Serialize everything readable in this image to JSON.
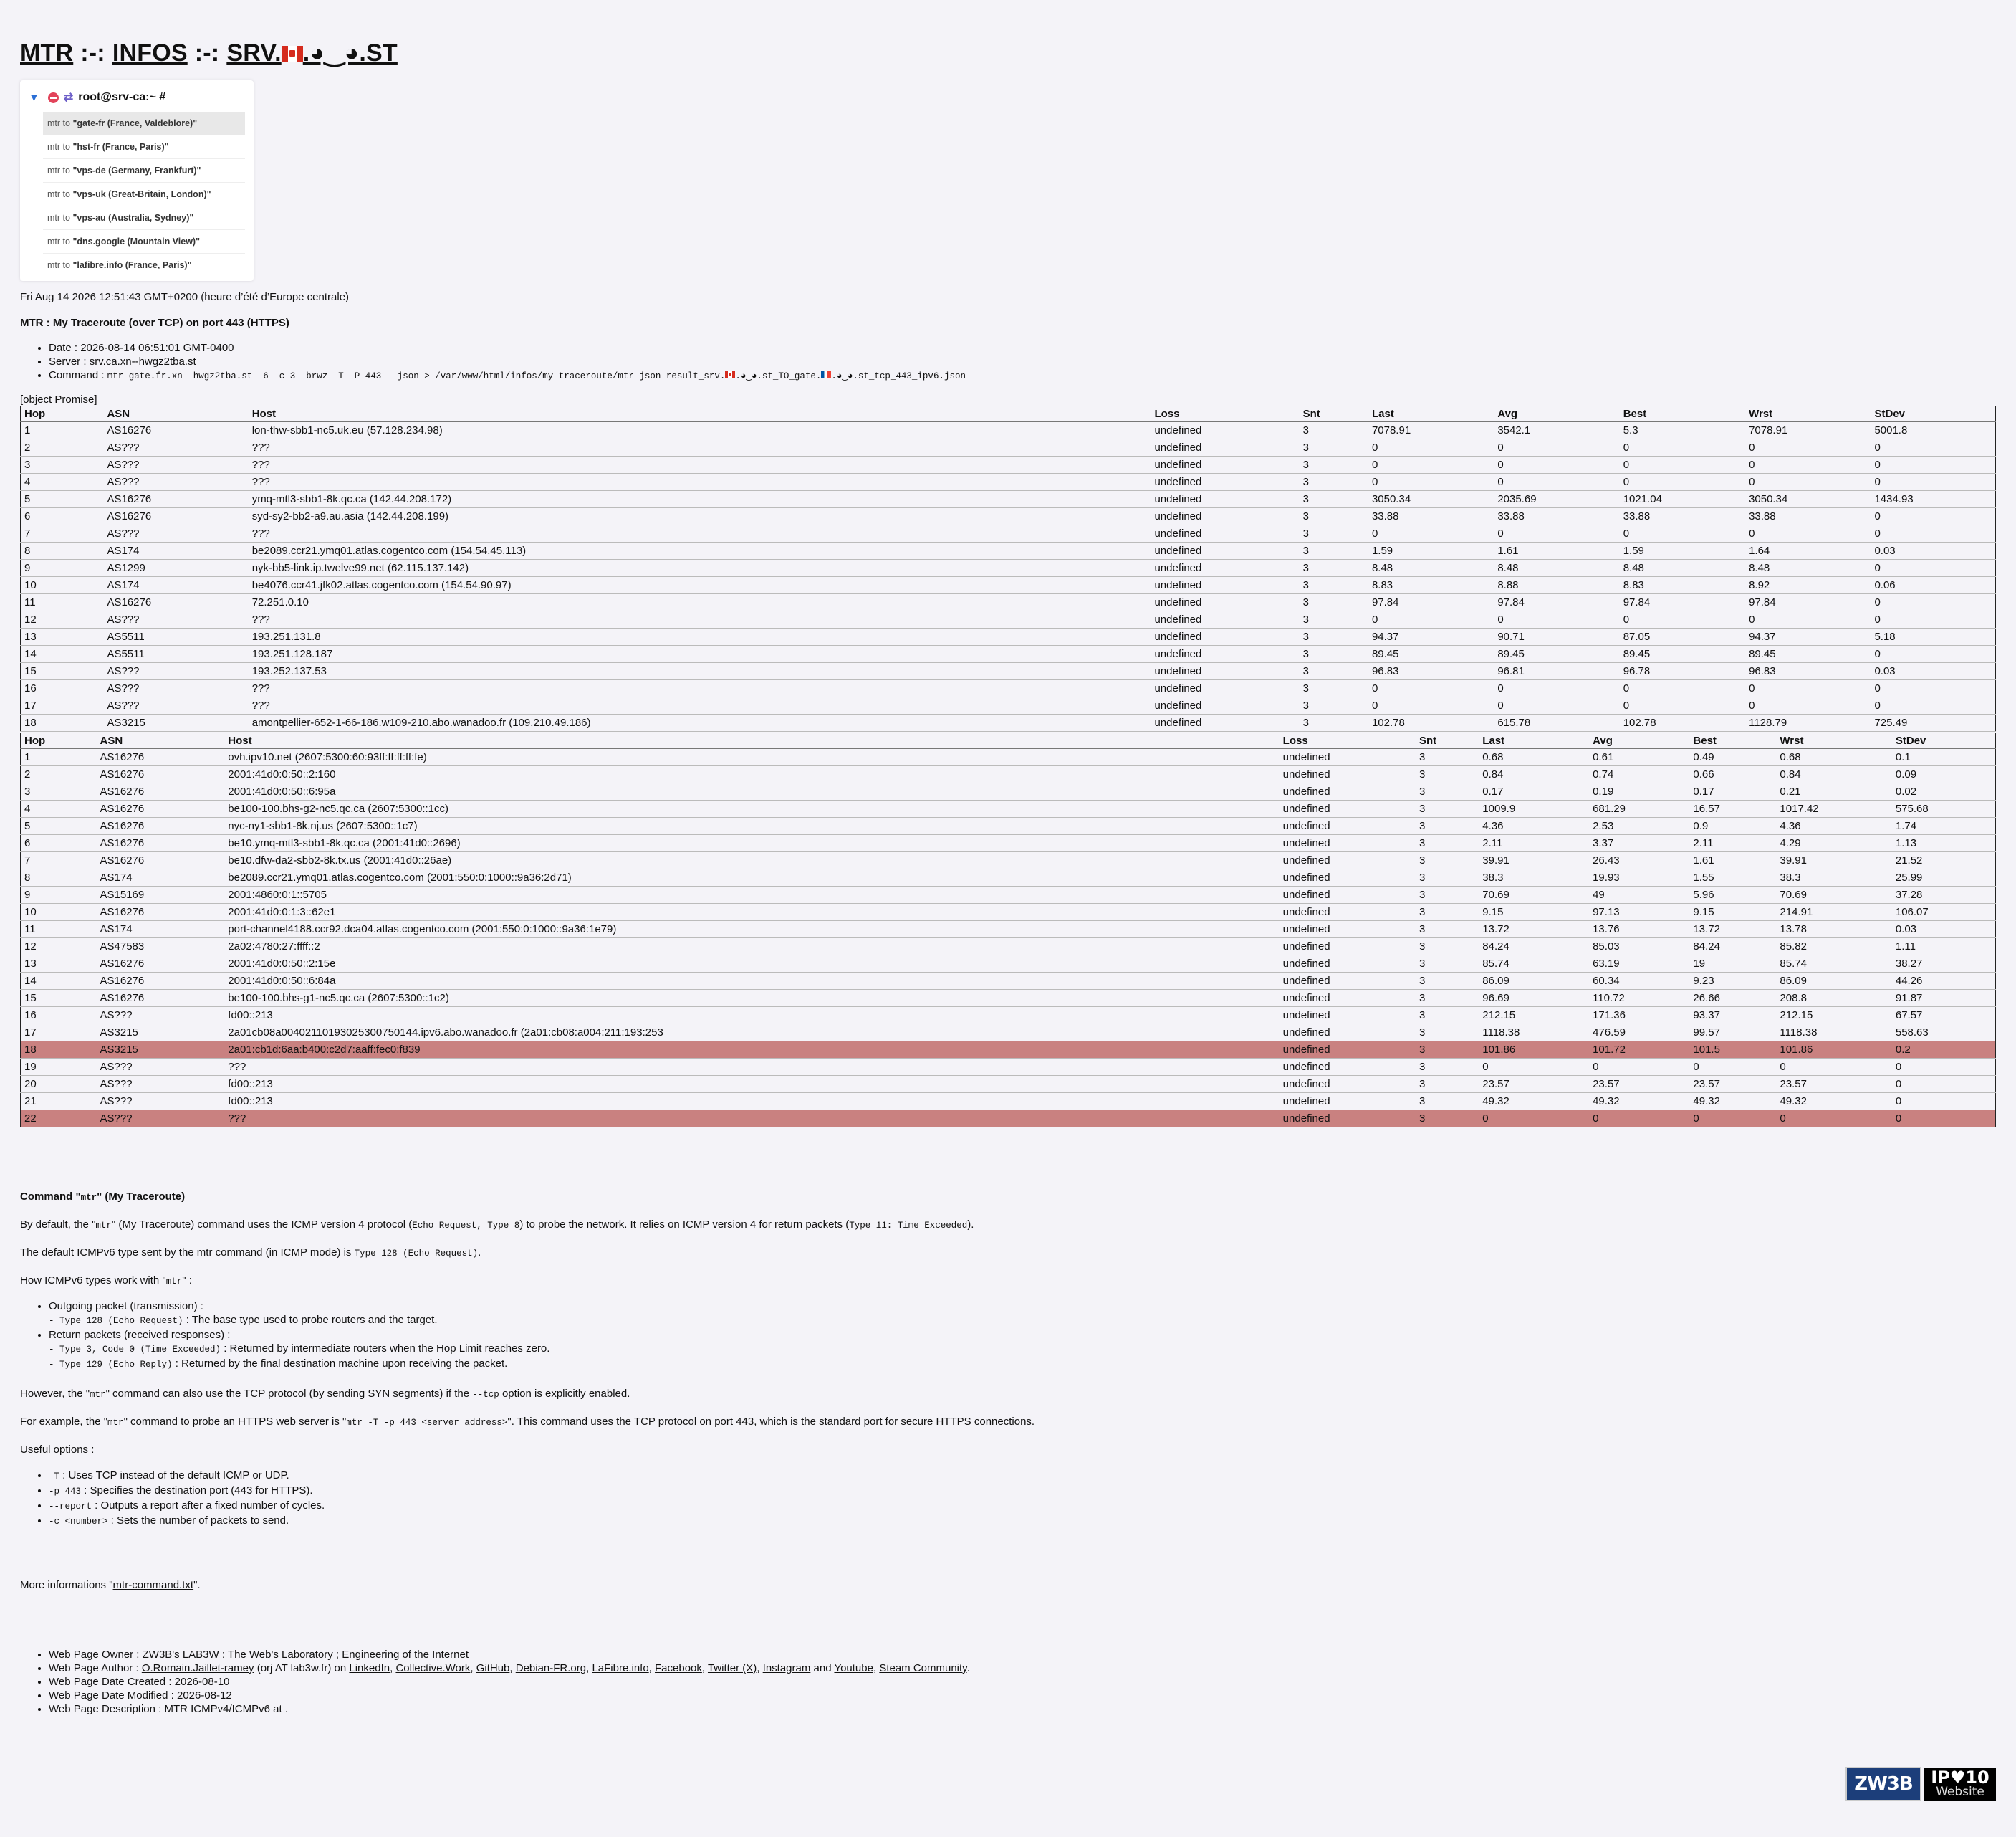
{
  "header": {
    "mtr": "MTR",
    "sep": ":-:",
    "infos": "INFOS",
    "srv_prefix": "SRV.",
    "srv_suffix": ".◕‿◕.ST"
  },
  "menu": {
    "prompt": "root@srv-ca:~ #",
    "prefix": "mtr to",
    "items": [
      "\"gate-fr (France, Valdeblore)\"",
      "\"hst-fr (France, Paris)\"",
      "\"vps-de (Germany, Frankfurt)\"",
      "\"vps-uk (Great-Britain, London)\"",
      "\"vps-au (Australia, Sydney)\"",
      "\"dns.google (Mountain View)\"",
      "\"lafibre.info (France, Paris)\""
    ]
  },
  "date_line": "Fri Aug 14 2026 12:51:43 GMT+0200 (heure d’été d’Europe centrale)",
  "mtr_title": "MTR : My Traceroute (over TCP) on port 443 (HTTPS)",
  "meta": {
    "date_label": "Date :",
    "date": "2026-08-14 06:51:01 GMT-0400",
    "server_label": "Server :",
    "server": "srv.ca.xn--hwgz2tba.st",
    "command_label": "Command :",
    "command_a": "mtr gate.fr.xn--hwgz2tba.st -6 -c 3 -brwz -T -P 443 --json > /var/www/html/infos/my-traceroute/mtr-json-result_srv.",
    "command_b": ".◕‿◕.st_TO_gate.",
    "command_c": ".◕‿◕.st_tcp_443_ipv6.json"
  },
  "promise": "[object Promise]",
  "columns": [
    "Hop",
    "ASN",
    "Host",
    "Loss",
    "Snt",
    "Last",
    "Avg",
    "Best",
    "Wrst",
    "StDev"
  ],
  "table1": [
    [
      "1",
      "AS16276",
      "lon-thw-sbb1-nc5.uk.eu (57.128.234.98)",
      "undefined",
      "3",
      "7078.91",
      "3542.1",
      "5.3",
      "7078.91",
      "5001.8"
    ],
    [
      "2",
      "AS???",
      "???",
      "undefined",
      "3",
      "0",
      "0",
      "0",
      "0",
      "0"
    ],
    [
      "3",
      "AS???",
      "???",
      "undefined",
      "3",
      "0",
      "0",
      "0",
      "0",
      "0"
    ],
    [
      "4",
      "AS???",
      "???",
      "undefined",
      "3",
      "0",
      "0",
      "0",
      "0",
      "0"
    ],
    [
      "5",
      "AS16276",
      "ymq-mtl3-sbb1-8k.qc.ca (142.44.208.172)",
      "undefined",
      "3",
      "3050.34",
      "2035.69",
      "1021.04",
      "3050.34",
      "1434.93"
    ],
    [
      "6",
      "AS16276",
      "syd-sy2-bb2-a9.au.asia (142.44.208.199)",
      "undefined",
      "3",
      "33.88",
      "33.88",
      "33.88",
      "33.88",
      "0"
    ],
    [
      "7",
      "AS???",
      "???",
      "undefined",
      "3",
      "0",
      "0",
      "0",
      "0",
      "0"
    ],
    [
      "8",
      "AS174",
      "be2089.ccr21.ymq01.atlas.cogentco.com (154.54.45.113)",
      "undefined",
      "3",
      "1.59",
      "1.61",
      "1.59",
      "1.64",
      "0.03"
    ],
    [
      "9",
      "AS1299",
      "nyk-bb5-link.ip.twelve99.net (62.115.137.142)",
      "undefined",
      "3",
      "8.48",
      "8.48",
      "8.48",
      "8.48",
      "0"
    ],
    [
      "10",
      "AS174",
      "be4076.ccr41.jfk02.atlas.cogentco.com (154.54.90.97)",
      "undefined",
      "3",
      "8.83",
      "8.88",
      "8.83",
      "8.92",
      "0.06"
    ],
    [
      "11",
      "AS16276",
      "72.251.0.10",
      "undefined",
      "3",
      "97.84",
      "97.84",
      "97.84",
      "97.84",
      "0"
    ],
    [
      "12",
      "AS???",
      "???",
      "undefined",
      "3",
      "0",
      "0",
      "0",
      "0",
      "0"
    ],
    [
      "13",
      "AS5511",
      "193.251.131.8",
      "undefined",
      "3",
      "94.37",
      "90.71",
      "87.05",
      "94.37",
      "5.18"
    ],
    [
      "14",
      "AS5511",
      "193.251.128.187",
      "undefined",
      "3",
      "89.45",
      "89.45",
      "89.45",
      "89.45",
      "0"
    ],
    [
      "15",
      "AS???",
      "193.252.137.53",
      "undefined",
      "3",
      "96.83",
      "96.81",
      "96.78",
      "96.83",
      "0.03"
    ],
    [
      "16",
      "AS???",
      "???",
      "undefined",
      "3",
      "0",
      "0",
      "0",
      "0",
      "0"
    ],
    [
      "17",
      "AS???",
      "???",
      "undefined",
      "3",
      "0",
      "0",
      "0",
      "0",
      "0"
    ],
    [
      "18",
      "AS3215",
      "amontpellier-652-1-66-186.w109-210.abo.wanadoo.fr (109.210.49.186)",
      "undefined",
      "3",
      "102.78",
      "615.78",
      "102.78",
      "1128.79",
      "725.49"
    ]
  ],
  "table2_highlight": [
    "18",
    "22"
  ],
  "table2": [
    [
      "1",
      "AS16276",
      "ovh.ipv10.net (2607:5300:60:93ff:ff:ff:ff:fe)",
      "undefined",
      "3",
      "0.68",
      "0.61",
      "0.49",
      "0.68",
      "0.1"
    ],
    [
      "2",
      "AS16276",
      "2001:41d0:0:50::2:160",
      "undefined",
      "3",
      "0.84",
      "0.74",
      "0.66",
      "0.84",
      "0.09"
    ],
    [
      "3",
      "AS16276",
      "2001:41d0:0:50::6:95a",
      "undefined",
      "3",
      "0.17",
      "0.19",
      "0.17",
      "0.21",
      "0.02"
    ],
    [
      "4",
      "AS16276",
      "be100-100.bhs-g2-nc5.qc.ca (2607:5300::1cc)",
      "undefined",
      "3",
      "1009.9",
      "681.29",
      "16.57",
      "1017.42",
      "575.68"
    ],
    [
      "5",
      "AS16276",
      "nyc-ny1-sbb1-8k.nj.us (2607:5300::1c7)",
      "undefined",
      "3",
      "4.36",
      "2.53",
      "0.9",
      "4.36",
      "1.74"
    ],
    [
      "6",
      "AS16276",
      "be10.ymq-mtl3-sbb1-8k.qc.ca (2001:41d0::2696)",
      "undefined",
      "3",
      "2.11",
      "3.37",
      "2.11",
      "4.29",
      "1.13"
    ],
    [
      "7",
      "AS16276",
      "be10.dfw-da2-sbb2-8k.tx.us (2001:41d0::26ae)",
      "undefined",
      "3",
      "39.91",
      "26.43",
      "1.61",
      "39.91",
      "21.52"
    ],
    [
      "8",
      "AS174",
      "be2089.ccr21.ymq01.atlas.cogentco.com (2001:550:0:1000::9a36:2d71)",
      "undefined",
      "3",
      "38.3",
      "19.93",
      "1.55",
      "38.3",
      "25.99"
    ],
    [
      "9",
      "AS15169",
      "2001:4860:0:1::5705",
      "undefined",
      "3",
      "70.69",
      "49",
      "5.96",
      "70.69",
      "37.28"
    ],
    [
      "10",
      "AS16276",
      "2001:41d0:0:1:3::62e1",
      "undefined",
      "3",
      "9.15",
      "97.13",
      "9.15",
      "214.91",
      "106.07"
    ],
    [
      "11",
      "AS174",
      "port-channel4188.ccr92.dca04.atlas.cogentco.com (2001:550:0:1000::9a36:1e79)",
      "undefined",
      "3",
      "13.72",
      "13.76",
      "13.72",
      "13.78",
      "0.03"
    ],
    [
      "12",
      "AS47583",
      "2a02:4780:27:ffff::2",
      "undefined",
      "3",
      "84.24",
      "85.03",
      "84.24",
      "85.82",
      "1.11"
    ],
    [
      "13",
      "AS16276",
      "2001:41d0:0:50::2:15e",
      "undefined",
      "3",
      "85.74",
      "63.19",
      "19",
      "85.74",
      "38.27"
    ],
    [
      "14",
      "AS16276",
      "2001:41d0:0:50::6:84a",
      "undefined",
      "3",
      "86.09",
      "60.34",
      "9.23",
      "86.09",
      "44.26"
    ],
    [
      "15",
      "AS16276",
      "be100-100.bhs-g1-nc5.qc.ca (2607:5300::1c2)",
      "undefined",
      "3",
      "96.69",
      "110.72",
      "26.66",
      "208.8",
      "91.87"
    ],
    [
      "16",
      "AS???",
      "fd00::213",
      "undefined",
      "3",
      "212.15",
      "171.36",
      "93.37",
      "212.15",
      "67.57"
    ],
    [
      "17",
      "AS3215",
      "2a01cb08a00402110193025300750144.ipv6.abo.wanadoo.fr (2a01:cb08:a004:211:193:253",
      "undefined",
      "3",
      "1118.38",
      "476.59",
      "99.57",
      "1118.38",
      "558.63"
    ],
    [
      "18",
      "AS3215",
      "2a01:cb1d:6aa:b400:c2d7:aaff:fec0:f839",
      "undefined",
      "3",
      "101.86",
      "101.72",
      "101.5",
      "101.86",
      "0.2"
    ],
    [
      "19",
      "AS???",
      "???",
      "undefined",
      "3",
      "0",
      "0",
      "0",
      "0",
      "0"
    ],
    [
      "20",
      "AS???",
      "fd00::213",
      "undefined",
      "3",
      "23.57",
      "23.57",
      "23.57",
      "23.57",
      "0"
    ],
    [
      "21",
      "AS???",
      "fd00::213",
      "undefined",
      "3",
      "49.32",
      "49.32",
      "49.32",
      "49.32",
      "0"
    ],
    [
      "22",
      "AS???",
      "???",
      "undefined",
      "3",
      "0",
      "0",
      "0",
      "0",
      "0"
    ]
  ],
  "doc": {
    "title_a": "Command \"",
    "title_code": "mtr",
    "title_b": "\" (My Traceroute)",
    "p1_a": "By default, the \"",
    "p1_code1": "mtr",
    "p1_b": "\" (My Traceroute) command uses the ICMP version 4 protocol (",
    "p1_code2": "Echo Request, Type 8",
    "p1_c": ") to probe the network. It relies on ICMP version 4 for return packets (",
    "p1_code3": "Type 11: Time Exceeded",
    "p1_d": ").",
    "p2_a": "The default ICMPv6 type sent by the mtr command (in ICMP mode) is ",
    "p2_code": "Type 128 (Echo Request)",
    "p2_b": ".",
    "p3_a": "How ICMPv6 types work with \"",
    "p3_code": "mtr",
    "p3_b": "\" :",
    "li1": "Outgoing packet (transmission) :",
    "li1_sub_code": "- Type 128 (Echo Request)",
    "li1_sub_text": " : The base type used to probe routers and the target.",
    "li2": "Return packets (received responses) :",
    "li2_sub1_code": "- Type 3, Code 0 (Time Exceeded)",
    "li2_sub1_text": " : Returned by intermediate routers when the Hop Limit reaches zero.",
    "li2_sub2_code": "- Type 129 (Echo Reply)",
    "li2_sub2_text": " : Returned by the final destination machine upon receiving the packet.",
    "p4_a": "However, the \"",
    "p4_code1": "mtr",
    "p4_b": "\" command can also use the TCP protocol (by sending SYN segments) if the ",
    "p4_code2": "--tcp",
    "p4_c": " option is explicitly enabled.",
    "p5_a": "For example, the \"",
    "p5_code1": "mtr",
    "p5_b": "\" command to probe an HTTPS web server is \"",
    "p5_code2": "mtr -T -p 443 <server_address>",
    "p5_c": "\". This command uses the TCP protocol on port 443, which is the standard port for secure HTTPS connections.",
    "p6": "Useful options :",
    "opt1_code": "-T",
    "opt1_text": " : Uses TCP instead of the default ICMP or UDP.",
    "opt2_code": "-p 443",
    "opt2_text": " : Specifies the destination port (443 for HTTPS).",
    "opt3_code": "--report",
    "opt3_text": " : Outputs a report after a fixed number of cycles.",
    "opt4_code": "-c <number>",
    "opt4_text": " : Sets the number of packets to send.",
    "more_a": "More informations \"",
    "more_link": "mtr-command.txt",
    "more_b": "\"."
  },
  "footer": {
    "owner": "Web Page Owner : ZW3B's LAB3W : The Web's Laboratory ; Engineering of the Internet",
    "author_a": "Web Page Author : ",
    "author_link": "O.Romain.Jaillet-ramey",
    "author_b": " (orj AT lab3w.fr) on ",
    "links": [
      "LinkedIn",
      "Collective.Work",
      "GitHub",
      "Debian-FR.org",
      "LaFibre.info",
      "Facebook",
      "Twitter (X)",
      "Instagram"
    ],
    "and": " and ",
    "links2": [
      "Youtube",
      "Steam Community"
    ],
    "created": "Web Page Date Created : 2026-08-10",
    "modified": "Web Page Date Modified : 2026-08-12",
    "description": "Web Page Description : MTR ICMPv4/ICMPv6 at ."
  },
  "badges": {
    "zw3b": "ZW3B",
    "ipv6_a": "IP♥10",
    "ipv6_b": "Website"
  }
}
